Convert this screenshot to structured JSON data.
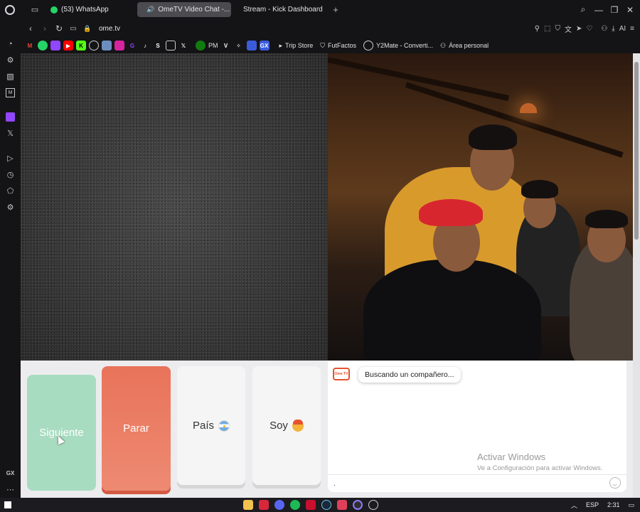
{
  "browser": {
    "tabs": [
      {
        "label": "(53) WhatsApp",
        "icon": "whatsapp-icon",
        "active": false
      },
      {
        "label": "OmeTV Video Chat -...",
        "icon": "ometv-icon",
        "active": true
      },
      {
        "label": "Stream - Kick Dashboard",
        "icon": "kick-icon",
        "active": false
      }
    ],
    "url": "ome.tv",
    "ai_label": "AI",
    "bookmarks": [
      {
        "label": "PM"
      },
      {
        "label": "Trip Store"
      },
      {
        "label": "FutFactos"
      },
      {
        "label": "Y2Mate - Converti..."
      },
      {
        "label": "Área personal"
      }
    ],
    "sidebar_bottom_label": "GX"
  },
  "controls": {
    "next_label": "Siguiente",
    "stop_label": "Parar",
    "country_label": "País",
    "iam_label": "Soy"
  },
  "chat": {
    "logo_text": "Ome TV",
    "status_message": "Buscando un compañero...",
    "input_value": ".",
    "watermark_title": "Activar Windows",
    "watermark_subtitle": "Ve a Configuración para activar Windows."
  },
  "taskbar": {
    "language": "ESP",
    "time": "2:31"
  },
  "colors": {
    "next_button": "#a8dcc0",
    "stop_button": "#e8735a",
    "ometv_brand": "#e5532e"
  }
}
